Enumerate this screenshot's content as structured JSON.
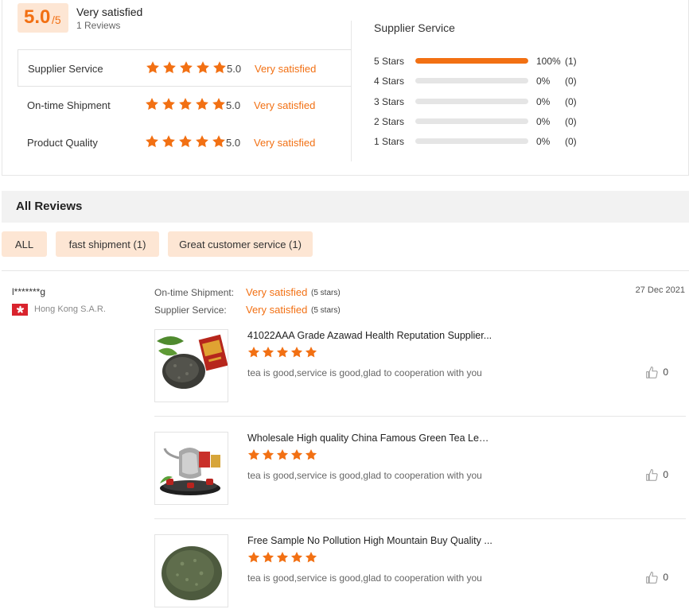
{
  "summary": {
    "score": "5.0",
    "score_denom": "/5",
    "label": "Very satisfied",
    "reviews_count": "1 Reviews",
    "accent_color": "#f27013",
    "rows": [
      {
        "label": "Supplier Service",
        "stars": 5,
        "score": "5.0",
        "text": "Very satisfied"
      },
      {
        "label": "On-time Shipment",
        "stars": 5,
        "score": "5.0",
        "text": "Very satisfied"
      },
      {
        "label": "Product Quality",
        "stars": 5,
        "score": "5.0",
        "text": "Very satisfied"
      }
    ]
  },
  "breakdown": {
    "title": "Supplier Service",
    "rows": [
      {
        "label": "5  Stars",
        "fraction": 1.0,
        "pct": "100%",
        "count": "(1)"
      },
      {
        "label": "4  Stars",
        "fraction": 0.0,
        "pct": "0%",
        "count": "(0)"
      },
      {
        "label": "3  Stars",
        "fraction": 0.0,
        "pct": "0%",
        "count": "(0)"
      },
      {
        "label": "2  Stars",
        "fraction": 0.0,
        "pct": "0%",
        "count": "(0)"
      },
      {
        "label": "1  Stars",
        "fraction": 0.0,
        "pct": "0%",
        "count": "(0)"
      }
    ]
  },
  "all_reviews": {
    "title": "All Reviews",
    "tags": [
      "ALL",
      "fast shipment (1)",
      "Great customer service (1)"
    ]
  },
  "review": {
    "reviewer": "l*******g",
    "country": "Hong Kong S.A.R.",
    "date": "27 Dec 2021",
    "meta": [
      {
        "label": "On-time Shipment:",
        "value": "Very satisfied",
        "stars": "(5 stars)"
      },
      {
        "label": "Supplier Service:",
        "value": "Very satisfied",
        "stars": "(5 stars)"
      }
    ],
    "products": [
      {
        "title": "41022AAA Grade Azawad Health Reputation Supplier...",
        "stars": 5,
        "comment": "tea is good,service is good,glad to cooperation with you",
        "likes": "0",
        "image": "loose-green-tea-with-package"
      },
      {
        "title": "Wholesale High quality China Famous Green Tea Leav...",
        "stars": 5,
        "comment": "tea is good,service is good,glad to cooperation with you",
        "likes": "0",
        "image": "tea-set-with-teapot"
      },
      {
        "title": "Free Sample No Pollution High Mountain Buy Quality ...",
        "stars": 5,
        "comment": "tea is good,service is good,glad to cooperation with you",
        "likes": "0",
        "image": "gunpowder-green-tea-pile"
      }
    ]
  }
}
